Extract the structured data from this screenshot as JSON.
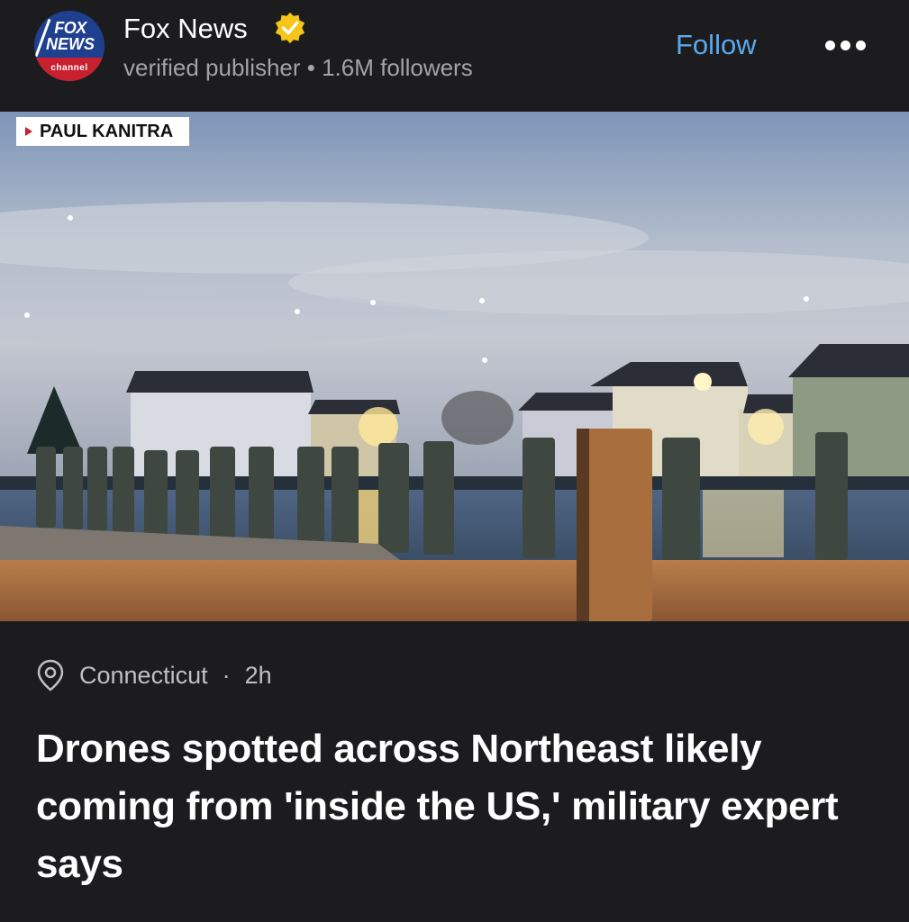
{
  "publisher": {
    "logo_text_top": "FOX",
    "logo_text_mid": "NEWS",
    "logo_text_bottom": "channel",
    "name": "Fox News",
    "meta": "verified publisher • 1.6M followers",
    "follow_label": "Follow",
    "verified_color": "#f5c518",
    "follow_color": "#5aa9ee"
  },
  "media": {
    "name_tag": "PAUL KANITRA"
  },
  "article": {
    "location": "Connecticut",
    "separator": "·",
    "age": "2h",
    "headline": "Drones spotted across Northeast likely coming from 'inside the US,' military expert says"
  }
}
